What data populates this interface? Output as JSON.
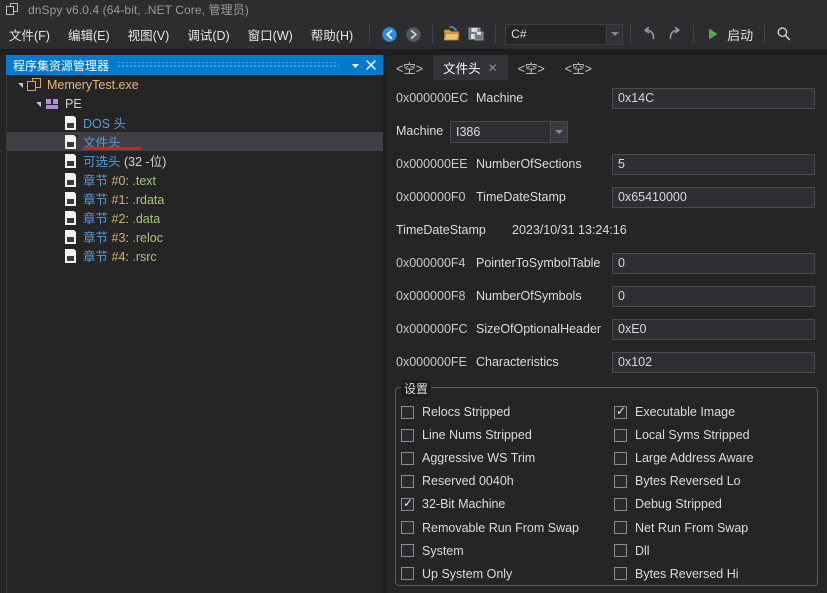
{
  "window": {
    "title": "dnSpy v6.0.4 (64-bit, .NET Core, 管理员)",
    "app_icon": "window-stack-icon"
  },
  "menubar": {
    "items": [
      {
        "label": "文件(F)",
        "name": "menu-file"
      },
      {
        "label": "编辑(E)",
        "name": "menu-edit"
      },
      {
        "label": "视图(V)",
        "name": "menu-view"
      },
      {
        "label": "调试(D)",
        "name": "menu-debug"
      },
      {
        "label": "窗口(W)",
        "name": "menu-window"
      },
      {
        "label": "帮助(H)",
        "name": "menu-help"
      }
    ]
  },
  "toolbar": {
    "back_icon": "navigate-back-icon",
    "forward_icon": "navigate-forward-icon",
    "open_icon": "open-folder-icon",
    "save_icon": "save-all-icon",
    "undo_icon": "undo-icon",
    "redo_icon": "redo-icon",
    "start_icon": "play-icon",
    "start_label": "启动",
    "search_icon": "search-icon",
    "language_combo": {
      "value": "C#",
      "arrow_icon": "chevron-down-icon"
    }
  },
  "left_panel": {
    "title": "程序集资源管理器",
    "menu_icon": "chevron-down-icon",
    "close_icon": "close-icon",
    "tree": [
      {
        "label": "MemeryTest.exe",
        "icon": "assembly-icon",
        "indent": 0,
        "expander": "expanded",
        "style": "asm",
        "selected": false
      },
      {
        "label": "PE",
        "icon": "pe-module-icon",
        "indent": 1,
        "expander": "expanded",
        "style": "plain",
        "selected": false
      },
      {
        "label": "DOS 头",
        "icon": "document-icon",
        "indent": 2,
        "expander": "none",
        "style": "blue",
        "selected": false
      },
      {
        "label": "文件头",
        "icon": "document-icon",
        "indent": 2,
        "expander": "none",
        "style": "blue",
        "selected": true,
        "annotated": true
      },
      {
        "label": "可选头 (32 -位)",
        "icon": "document-icon",
        "indent": 2,
        "expander": "none",
        "style": "blue",
        "selected": false
      },
      {
        "label": "章节 #0: .text",
        "icon": "document-icon",
        "indent": 2,
        "expander": "none",
        "style": "section",
        "selected": false
      },
      {
        "label": "章节 #1: .rdata",
        "icon": "document-icon",
        "indent": 2,
        "expander": "none",
        "style": "section",
        "selected": false
      },
      {
        "label": "章节 #2: .data",
        "icon": "document-icon",
        "indent": 2,
        "expander": "none",
        "style": "section",
        "selected": false
      },
      {
        "label": "章节 #3: .reloc",
        "icon": "document-icon",
        "indent": 2,
        "expander": "none",
        "style": "section",
        "selected": false
      },
      {
        "label": "章节 #4: .rsrc",
        "icon": "document-icon",
        "indent": 2,
        "expander": "none",
        "style": "section",
        "selected": false
      }
    ]
  },
  "tabs": [
    {
      "label": "<空>",
      "active": false,
      "closable": false
    },
    {
      "label": "文件头",
      "active": true,
      "closable": true,
      "close_icon": "close-icon"
    },
    {
      "label": "<空>",
      "active": false,
      "closable": false
    },
    {
      "label": "<空>",
      "active": false,
      "closable": false
    }
  ],
  "fields": [
    {
      "kind": "input",
      "offset": "0x000000EC",
      "name": "Machine",
      "value": "0x14C"
    },
    {
      "kind": "combo",
      "name": "Machine",
      "value": "I386",
      "arrow_icon": "chevron-down-icon"
    },
    {
      "kind": "input",
      "offset": "0x000000EE",
      "name": "NumberOfSections",
      "value": "5"
    },
    {
      "kind": "input",
      "offset": "0x000000F0",
      "name": "TimeDateStamp",
      "value": "0x65410000"
    },
    {
      "kind": "readonly",
      "name": "TimeDateStamp",
      "value": "2023/10/31 13:24:16"
    },
    {
      "kind": "input",
      "offset": "0x000000F4",
      "name": "PointerToSymbolTable",
      "value": "0"
    },
    {
      "kind": "input",
      "offset": "0x000000F8",
      "name": "NumberOfSymbols",
      "value": "0"
    },
    {
      "kind": "input",
      "offset": "0x000000FC",
      "name": "SizeOfOptionalHeader",
      "value": "0xE0"
    },
    {
      "kind": "input",
      "offset": "0x000000FE",
      "name": "Characteristics",
      "value": "0x102"
    }
  ],
  "settings_group": {
    "legend": "设置",
    "left_column": [
      {
        "label": "Relocs Stripped",
        "checked": false
      },
      {
        "label": "Line Nums Stripped",
        "checked": false
      },
      {
        "label": "Aggressive WS Trim",
        "checked": false
      },
      {
        "label": "Reserved 0040h",
        "checked": false
      },
      {
        "label": "32-Bit Machine",
        "checked": true
      },
      {
        "label": "Removable Run From Swap",
        "checked": false
      },
      {
        "label": "System",
        "checked": false
      },
      {
        "label": "Up System Only",
        "checked": false
      }
    ],
    "right_column": [
      {
        "label": "Executable Image",
        "checked": true
      },
      {
        "label": "Local Syms Stripped",
        "checked": false
      },
      {
        "label": "Large Address Aware",
        "checked": false
      },
      {
        "label": "Bytes Reversed Lo",
        "checked": false
      },
      {
        "label": "Debug Stripped",
        "checked": false
      },
      {
        "label": "Net Run From Swap",
        "checked": false
      },
      {
        "label": "Dll",
        "checked": false
      },
      {
        "label": "Bytes Reversed Hi",
        "checked": false
      }
    ]
  },
  "colors": {
    "accent_blue": "#007acc",
    "background": "#1e1e1e",
    "panel": "#252526",
    "annotation_red": "#e01b1b",
    "assembly_orange": "#e8b774",
    "tree_blue": "#5a9bd5",
    "section_orange": "#e8955a",
    "start_green": "#4caf50"
  }
}
